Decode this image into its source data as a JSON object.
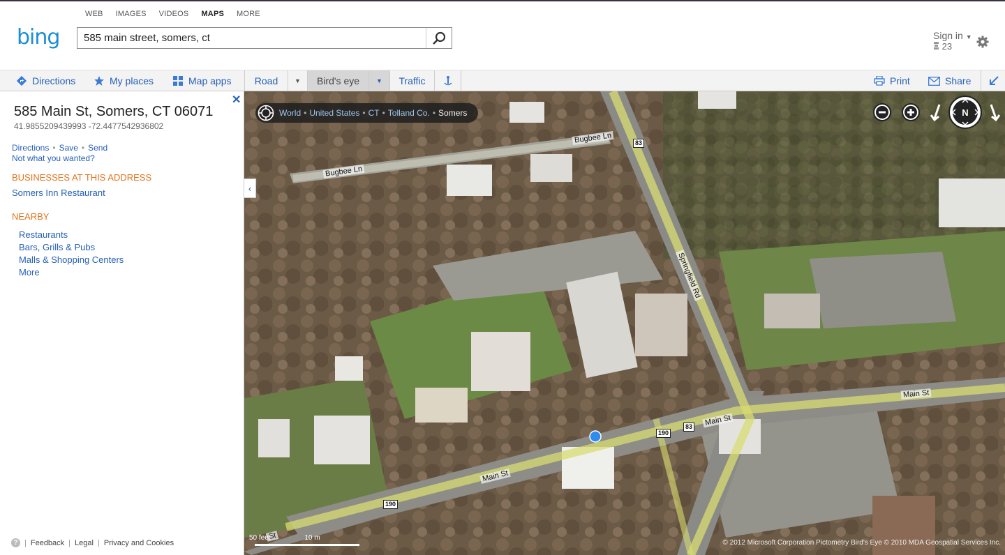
{
  "header": {
    "nav": [
      "WEB",
      "IMAGES",
      "VIDEOS",
      "MAPS",
      "MORE"
    ],
    "active_nav": "MAPS",
    "logo": "bing",
    "search_value": "585 main street, somers, ct",
    "signin": "Sign in",
    "points": "23"
  },
  "toolbar": {
    "directions": "Directions",
    "my_places": "My places",
    "map_apps": "Map apps",
    "road": "Road",
    "birds_eye": "Bird's eye",
    "traffic": "Traffic",
    "print": "Print",
    "share": "Share"
  },
  "panel": {
    "address": "585 Main St, Somers, CT 06071",
    "coords": "41.9855209439993 -72.4477542936802",
    "actions": [
      "Directions",
      "Save",
      "Send"
    ],
    "not_wanted": "Not what you wanted?",
    "businesses_header": "BUSINESSES AT THIS ADDRESS",
    "business": "Somers Inn Restaurant",
    "nearby_header": "NEARBY",
    "nearby": [
      "Restaurants",
      "Bars, Grills & Pubs",
      "Malls & Shopping Centers",
      "More"
    ],
    "footer": {
      "feedback": "Feedback",
      "legal": "Legal",
      "privacy": "Privacy and Cookies"
    }
  },
  "map": {
    "breadcrumb": [
      "World",
      "United States",
      "CT",
      "Tolland Co.",
      "Somers"
    ],
    "road_labels": {
      "bugbee1": "Bugbee Ln",
      "bugbee2": "Bugbee Ln",
      "springfield": "Springfield Rd",
      "main1": "Main St",
      "main2": "Main St",
      "main3": "Main St",
      "main4": "St"
    },
    "shields": {
      "s83a": "83",
      "s83b": "83",
      "s190a": "190",
      "s190b": "190"
    },
    "scale_feet": "50 feet",
    "scale_m": "10 m",
    "copyright": "© 2012 Microsoft Corporation   Pictometry Bird's Eye © 2010 MDA Geospatial Services Inc."
  }
}
